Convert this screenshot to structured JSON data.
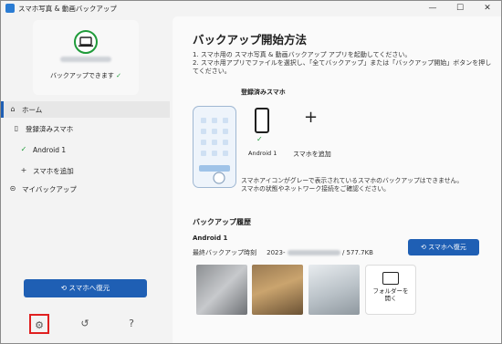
{
  "window": {
    "title": "スマホ写真 & 動画バックアップ",
    "minimize": "—",
    "maximize": "☐",
    "close": "✕"
  },
  "sidebar": {
    "device_status": "バックアップできます",
    "items": [
      {
        "label": "ホーム",
        "icon": "home-icon"
      },
      {
        "label": "登録済みスマホ",
        "icon": "phone-icon"
      },
      {
        "label": "Android 1",
        "icon": "check-circle-icon"
      },
      {
        "label": "スマホを追加",
        "icon": "plus-icon"
      },
      {
        "label": "マイバックアップ",
        "icon": "folder-icon"
      }
    ],
    "restore_button": "⟲ スマホへ復元",
    "bottom_icons": [
      "gear-icon",
      "history-icon",
      "help-icon"
    ]
  },
  "main": {
    "title": "バックアップ開始方法",
    "instructions": [
      "1. スマホ用の スマホ写真 & 動画バックアップ アプリを起動してください。",
      "2. スマホ用アプリでファイルを選択し、「全てバックアップ」または「バックアップ開始」ボタンを押してください。"
    ],
    "registered_label": "登録済みスマホ",
    "device_label": "Android 1",
    "add_label": "スマホを追加",
    "note": [
      "スマホアイコンがグレーで表示されているスマホのバックアップはできません。",
      "スマホの状態やネットワーク接続をご確認ください。"
    ],
    "history_title": "バックアップ履歴",
    "history_device": "Android 1",
    "last_backup_label": "最終バックアップ時刻",
    "last_backup_time_prefix": "2023-",
    "last_backup_size": "/ 577.7KB",
    "restore_button": "⟲ スマホへ復元",
    "folder_label_1": "フォルダーを",
    "folder_label_2": "開く"
  },
  "colors": {
    "accent": "#1f5fb4",
    "check": "#1f9b3a",
    "highlight": "#e02020"
  }
}
